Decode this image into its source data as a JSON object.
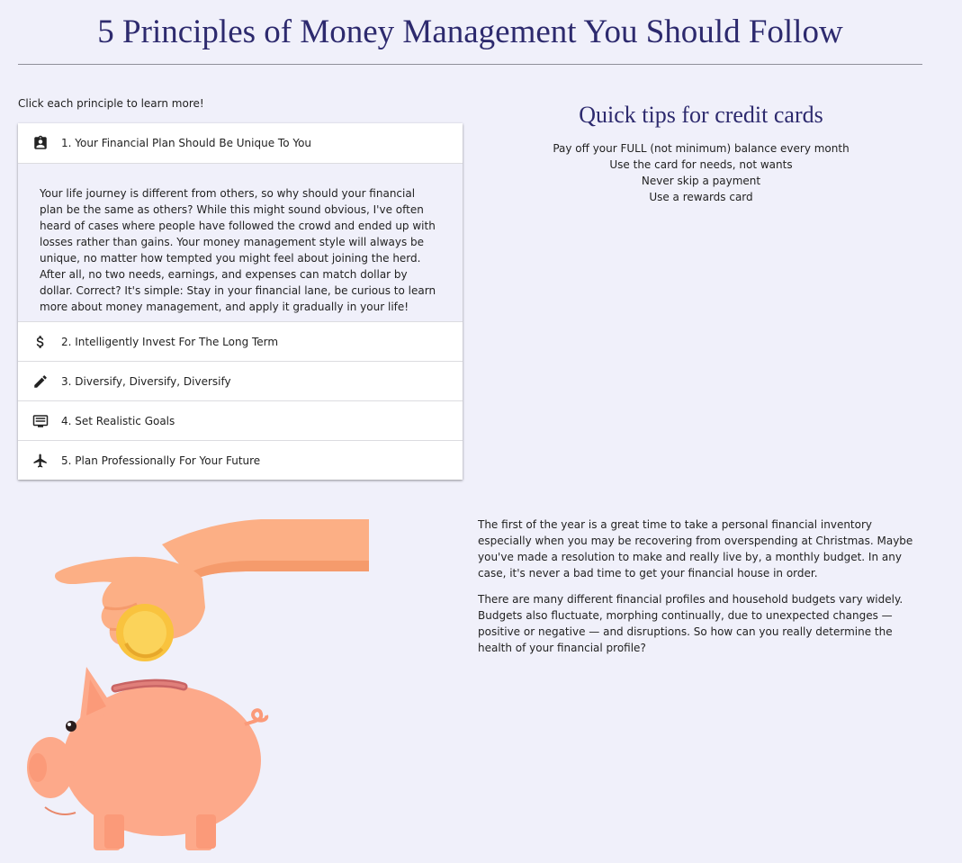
{
  "header": {
    "title": "5 Principles of Money Management You Should Follow"
  },
  "principles": {
    "hint": "Click each principle to learn more!",
    "items": [
      {
        "label": "1. Your Financial Plan Should Be Unique To You",
        "icon": "clipboard-account-icon",
        "expanded": true,
        "body": "Your life journey is different from others, so why should your financial plan be the same as others? While this might sound obvious, I've often heard of cases where people have followed the crowd and ended up with losses rather than gains. Your money management style will always be unique, no matter how tempted you might feel about joining the herd. After all, no two needs, earnings, and expenses can match dollar by dollar. Correct? It's simple: Stay in your financial lane, be curious to learn more about money management, and apply it gradually in your life!"
      },
      {
        "label": "2. Intelligently Invest For The Long Term",
        "icon": "dollar-icon",
        "expanded": false
      },
      {
        "label": "3. Diversify, Diversify, Diversify",
        "icon": "pencil-icon",
        "expanded": false
      },
      {
        "label": "4. Set Realistic Goals",
        "icon": "monitor-icon",
        "expanded": false
      },
      {
        "label": "5. Plan Professionally For Your Future",
        "icon": "airplane-icon",
        "expanded": false
      }
    ]
  },
  "tips": {
    "title": "Quick tips for credit cards",
    "items": [
      "Pay off your FULL (not minimum) balance every month",
      "Use the card for needs, not wants",
      "Never skip a payment",
      "Use a rewards card"
    ]
  },
  "article": {
    "paragraphs": [
      "The first of the year is a great time to take a personal financial inventory especially when you may be recovering from overspending at Christmas. Maybe you've made a resolution to make and really live by, a monthly budget. In any case, it's never a bad time to get your financial house in order.",
      "There are many different financial profiles and household budgets vary widely. Budgets also fluctuate, morphing continually, due to unexpected changes — positive or negative — and disruptions. So how can you really determine the health of your financial profile?"
    ]
  },
  "colors": {
    "background": "#f0f0fa",
    "heading": "#2d2a6e",
    "pig": "#fda98a",
    "hand": "#fcaf85",
    "coin": "#f9c33e"
  }
}
